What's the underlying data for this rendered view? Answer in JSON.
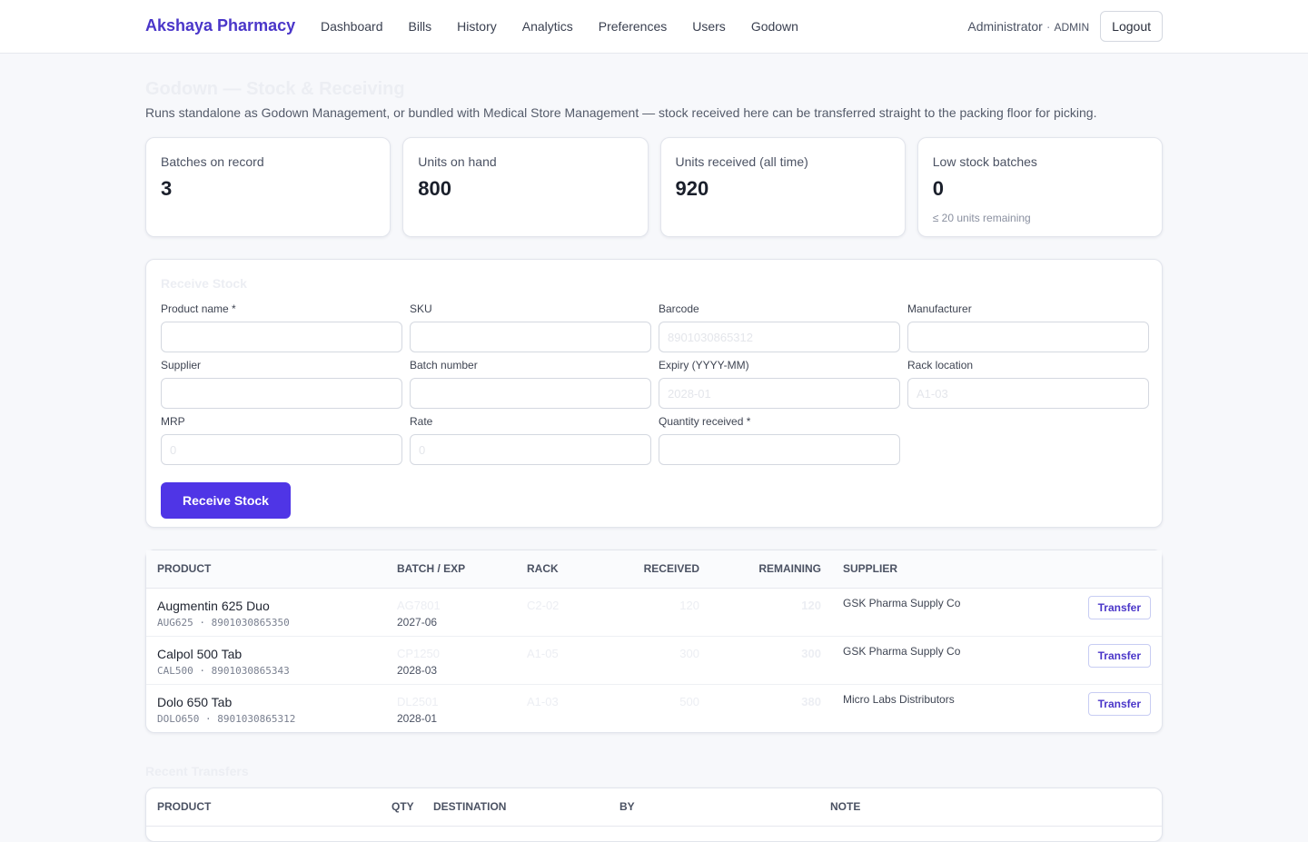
{
  "header": {
    "brand": "Akshaya Pharmacy",
    "nav": [
      "Dashboard",
      "Bills",
      "History",
      "Analytics",
      "Preferences",
      "Users",
      "Godown"
    ],
    "user_name": "Administrator",
    "separator": "·",
    "role": "ADMIN",
    "logout_label": "Logout"
  },
  "page": {
    "title": "Godown — Stock & Receiving",
    "subtitle": "Runs standalone as Godown Management, or bundled with Medical Store Management — stock received here can be transferred straight to the packing floor for picking."
  },
  "stats": [
    {
      "label": "Batches on record",
      "value": "3",
      "hint": ""
    },
    {
      "label": "Units on hand",
      "value": "800",
      "hint": ""
    },
    {
      "label": "Units received (all time)",
      "value": "920",
      "hint": ""
    },
    {
      "label": "Low stock batches",
      "value": "0",
      "hint": "≤ 20 units remaining"
    }
  ],
  "receive": {
    "title": "Receive Stock",
    "fields": [
      {
        "label": "Product name *",
        "placeholder": ""
      },
      {
        "label": "SKU",
        "placeholder": ""
      },
      {
        "label": "Barcode",
        "placeholder": "8901030865312"
      },
      {
        "label": "Manufacturer",
        "placeholder": ""
      },
      {
        "label": "Supplier",
        "placeholder": ""
      },
      {
        "label": "Batch number",
        "placeholder": ""
      },
      {
        "label": "Expiry (YYYY-MM)",
        "placeholder": "2028-01"
      },
      {
        "label": "Rack location",
        "placeholder": "A1-03"
      },
      {
        "label": "MRP",
        "placeholder": "0"
      },
      {
        "label": "Rate",
        "placeholder": "0"
      },
      {
        "label": "Quantity received *",
        "placeholder": ""
      }
    ],
    "submit_label": "Receive Stock"
  },
  "stock_table": {
    "headers": [
      "PRODUCT",
      "BATCH / EXP",
      "RACK",
      "RECEIVED",
      "REMAINING",
      "SUPPLIER"
    ],
    "action_label": "Transfer",
    "rows": [
      {
        "name": "Augmentin 625 Duo",
        "meta": "AUG625 · 8901030865350",
        "batch": "AG7801",
        "exp": "2027-06",
        "rack": "C2-02",
        "received": "120",
        "remaining": "120",
        "supplier": "GSK Pharma Supply Co"
      },
      {
        "name": "Calpol 500 Tab",
        "meta": "CAL500 · 8901030865343",
        "batch": "CP1250",
        "exp": "2028-03",
        "rack": "A1-05",
        "received": "300",
        "remaining": "300",
        "supplier": "GSK Pharma Supply Co"
      },
      {
        "name": "Dolo 650 Tab",
        "meta": "DOLO650 · 8901030865312",
        "batch": "DL2501",
        "exp": "2028-01",
        "rack": "A1-03",
        "received": "500",
        "remaining": "380",
        "supplier": "Micro Labs Distributors"
      }
    ]
  },
  "recent_transfers": {
    "title": "Recent Transfers",
    "headers": [
      "PRODUCT",
      "QTY",
      "DESTINATION",
      "BY",
      "NOTE"
    ]
  }
}
